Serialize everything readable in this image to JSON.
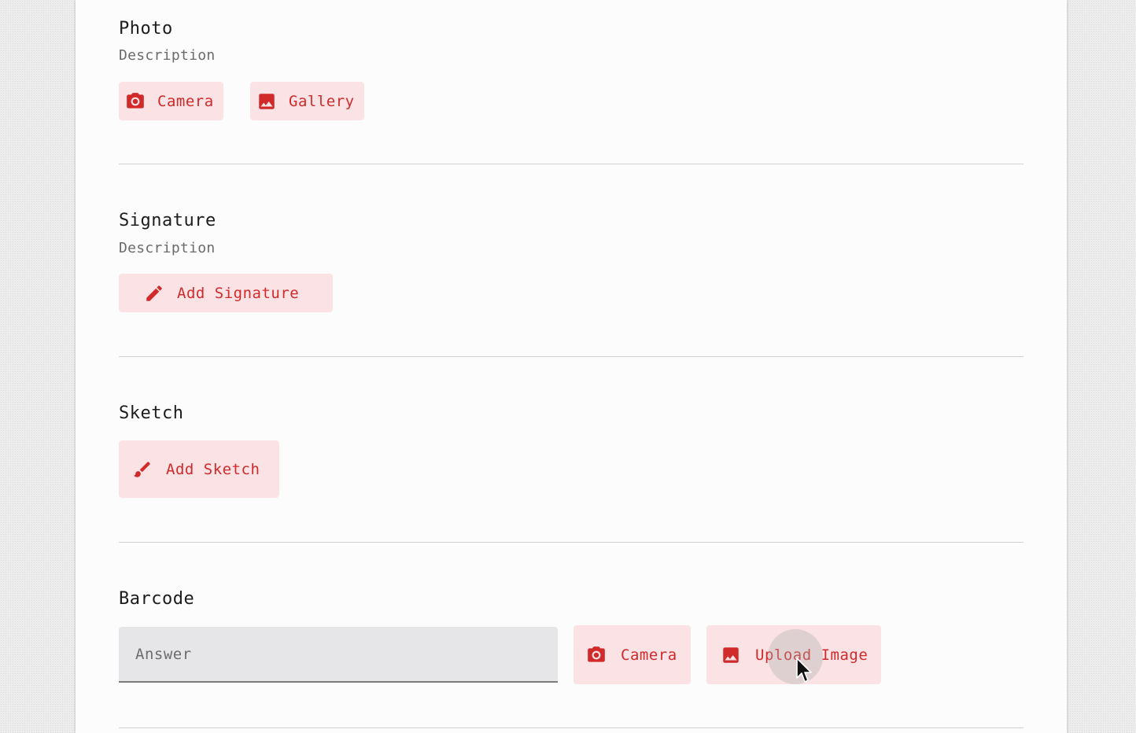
{
  "photo": {
    "title": "Photo",
    "description": "Description",
    "camera_label": "Camera",
    "gallery_label": "Gallery"
  },
  "signature": {
    "title": "Signature",
    "description": "Description",
    "add_label": "Add Signature"
  },
  "sketch": {
    "title": "Sketch",
    "add_label": "Add Sketch"
  },
  "barcode": {
    "title": "Barcode",
    "answer_placeholder": "Answer",
    "camera_label": "Camera",
    "upload_label": "Upload Image"
  },
  "colors": {
    "accent": "#d12a2a",
    "button_bg": "#fbe3e5",
    "card_bg": "#fcfcfd"
  },
  "icons": [
    "camera-icon",
    "image-icon",
    "pencil-icon",
    "brush-icon"
  ]
}
